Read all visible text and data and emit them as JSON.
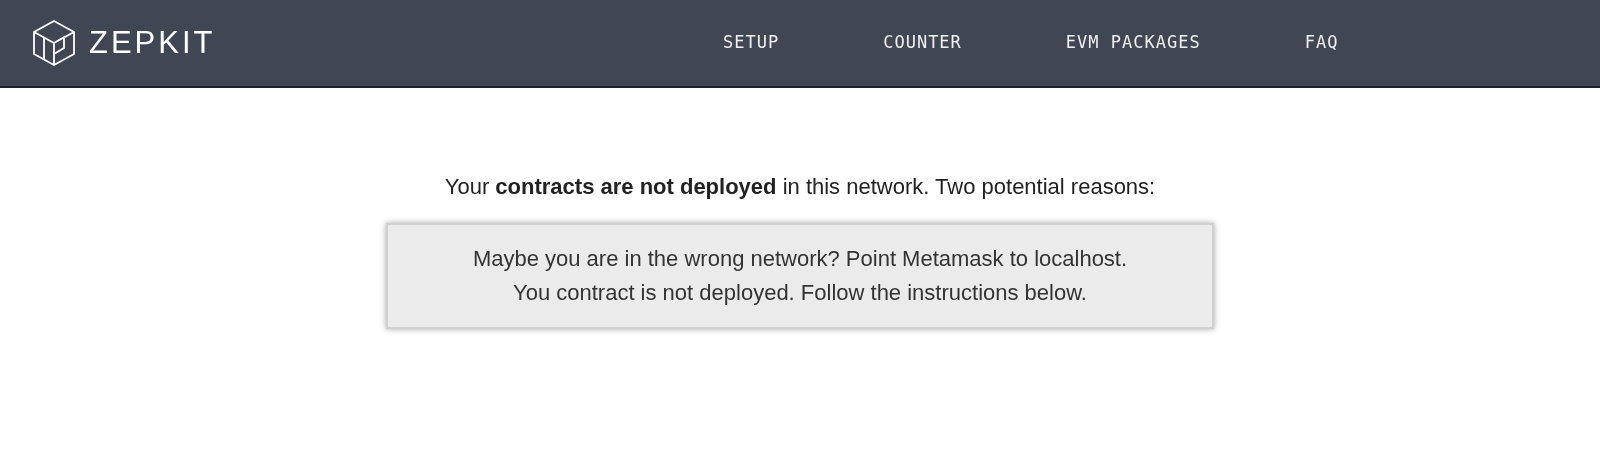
{
  "header": {
    "logo_text": "ZEPKIT",
    "nav": [
      {
        "label": "SETUP"
      },
      {
        "label": "COUNTER"
      },
      {
        "label": "EVM PACKAGES"
      },
      {
        "label": "FAQ"
      }
    ]
  },
  "message": "Your **contracts are not deployed** in this network. Two potential reasons:",
  "reasons": [
    "Maybe you are in the wrong network? Point Metamask to localhost.",
    "You contract is not deployed. Follow the instructions below."
  ]
}
